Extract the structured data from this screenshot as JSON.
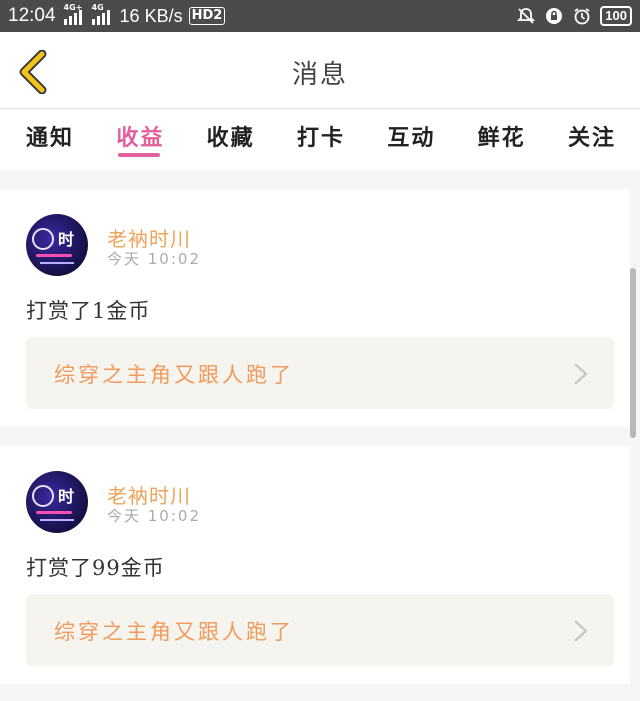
{
  "status_bar": {
    "time": "12:04",
    "sim1_tag": "4G+",
    "sim2_tag": "4G",
    "speed": "16 KB/s",
    "hd": "HD2",
    "battery": "100"
  },
  "header": {
    "title": "消息",
    "back_icon": "chevron-left-icon"
  },
  "tabs": [
    {
      "label": "通知",
      "active": false
    },
    {
      "label": "收益",
      "active": true
    },
    {
      "label": "收藏",
      "active": false
    },
    {
      "label": "打卡",
      "active": false
    },
    {
      "label": "互动",
      "active": false
    },
    {
      "label": "鲜花",
      "active": false
    },
    {
      "label": "关注",
      "active": false
    }
  ],
  "messages": [
    {
      "user": "老衲时川",
      "time": "今天 10:02",
      "text": "打赏了1金币",
      "book_title": "综穿之主角又跟人跑了"
    },
    {
      "user": "老衲时川",
      "time": "今天 10:02",
      "text": "打赏了99金币",
      "book_title": "综穿之主角又跟人跑了"
    }
  ],
  "colors": {
    "accent": "#e2609c",
    "back_icon": "#f2c418",
    "username": "#f0a35a",
    "book_title": "#f09a5c"
  }
}
